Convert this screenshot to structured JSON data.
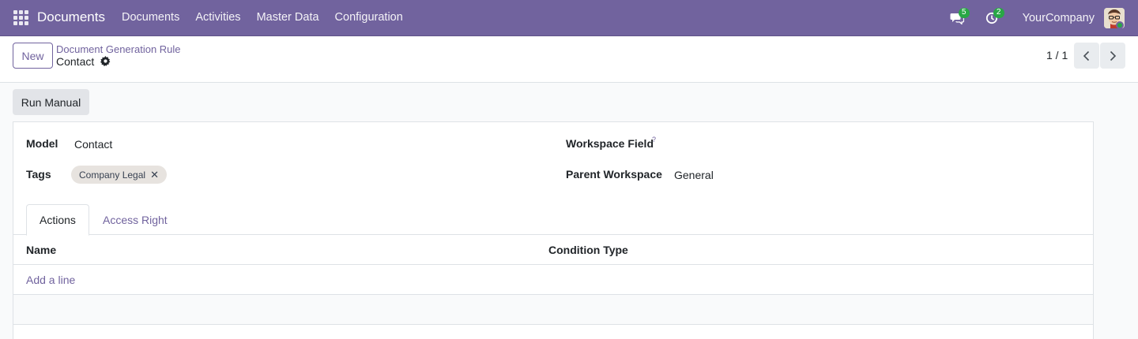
{
  "navbar": {
    "brand": "Documents",
    "menu": [
      "Documents",
      "Activities",
      "Master Data",
      "Configuration"
    ],
    "messages_count": "5",
    "activities_count": "2",
    "company": "YourCompany"
  },
  "control_panel": {
    "new_label": "New",
    "breadcrumb_parent": "Document Generation Rule",
    "breadcrumb_current": "Contact",
    "pager": "1 / 1"
  },
  "actions": {
    "run_manual_label": "Run Manual"
  },
  "form": {
    "model_label": "Model",
    "model_value": "Contact",
    "tags_label": "Tags",
    "tags": [
      "Company Legal"
    ],
    "workspace_field_label": "Workspace Field",
    "workspace_field_tooltip": "?",
    "workspace_field_value": "",
    "parent_workspace_label": "Parent Workspace",
    "parent_workspace_value": "General"
  },
  "tabs": [
    "Actions",
    "Access Right"
  ],
  "table": {
    "columns": [
      "Name",
      "Condition Type"
    ],
    "add_line_label": "Add a line"
  },
  "colors": {
    "brand": "#71639e",
    "badge": "#28a745"
  }
}
